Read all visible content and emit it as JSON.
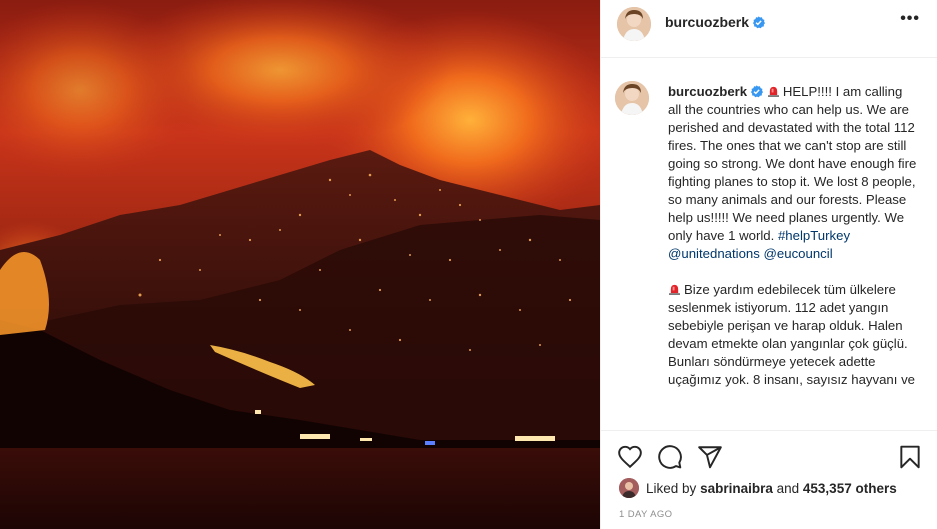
{
  "post": {
    "username": "burcuozberk",
    "more_label": "•••"
  },
  "caption": {
    "username": "burcuozberk",
    "p1": "HELP!!!! I am calling all the countries who can help us. We are perished and devastated with the total 112 fires. The ones that we can't stop are still going so strong. We dont have enough fire fighting planes to stop it. We lost 8 people, so many animals and our forests. Please help us!!!!! We need planes urgently. We only have 1 world.",
    "hashtag": "#helpTurkey",
    "mention1": "@unitednations",
    "mention2": "@eucouncil",
    "p2": "Bize yardım edebilecek tüm ülkelere seslenmek istiyorum. 112 adet yangın sebebiyle perişan ve harap olduk. Halen devam etmekte olan yangınlar çok güçlü. Bunları söndürmeye yetecek adette uçağımız yok. 8 insanı, sayısız hayvanı ve"
  },
  "likes": {
    "prefix": "Liked by",
    "user": "sabrinaibra",
    "and": "and",
    "count": "453,357 others"
  },
  "timestamp": "1 DAY AGO",
  "icons": [
    "verified-badge-icon",
    "more-options-icon",
    "heart-icon",
    "comment-icon",
    "share-icon",
    "bookmark-icon",
    "alarm-siren-emoji"
  ],
  "colors": {
    "verified": "#3897f0",
    "link": "#00376b",
    "muted": "#8e8e8e"
  }
}
